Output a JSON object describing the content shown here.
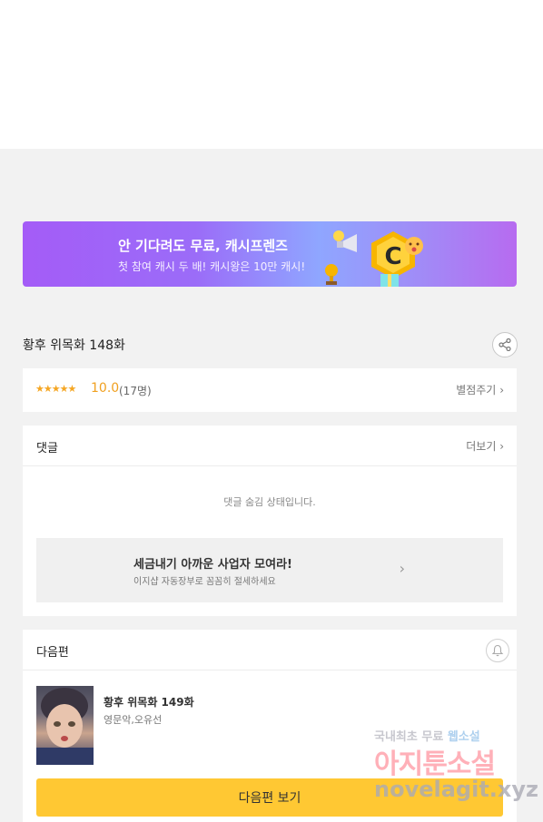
{
  "banner": {
    "title": "안 기다려도 무료, 캐시프렌즈",
    "subtitle": "첫 참여 캐시 두 배! 캐시왕은 10만 캐시!",
    "coin_letter": "C"
  },
  "episode": {
    "title": "황후 위목화 148화",
    "share_icon": "share-icon"
  },
  "rating": {
    "stars": "★★★★★",
    "score": "10.0",
    "count": "(17명)",
    "rate_label": "별점주기"
  },
  "comments": {
    "label": "댓글",
    "more_label": "더보기",
    "hidden_message": "댓글 숨김 상태입니다.",
    "ad_title": "세금내기 아까운 사업자 모여라!",
    "ad_subtitle": "이지샵 자동장부로 꼼꼼히 절세하세요"
  },
  "next": {
    "label": "다음편",
    "episode_title": "황후 위목화 149화",
    "authors": "영문악,오유선",
    "button_label": "다음편 보기"
  },
  "watermark": {
    "line1_a": "국내최초 무료",
    "line1_b": "웹소설",
    "line2": "아지툰소설",
    "line3": "novelagit.xyz"
  },
  "colors": {
    "accent_yellow": "#ffc833",
    "rating_orange": "#f0a020",
    "banner_purple": "#a45cf7"
  }
}
